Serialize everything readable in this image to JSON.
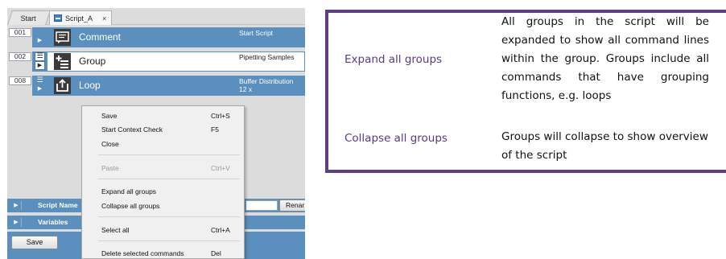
{
  "tabs": {
    "start_label": "Start",
    "script_label": "Script_A",
    "close_glyph": "×"
  },
  "commands": [
    {
      "number": "001",
      "label": "Comment",
      "detail": [
        "Start Script"
      ],
      "icon": "comment-icon"
    },
    {
      "number": "002",
      "label": "Group",
      "detail": [
        "Pipetting Samples"
      ],
      "icon": "group-icon"
    },
    {
      "number": "008",
      "label": "Loop",
      "detail": [
        "Buffer Distribution",
        "12 x"
      ],
      "icon": "loop-icon"
    }
  ],
  "context_menu": {
    "items": [
      {
        "label": "Save",
        "shortcut": "Ctrl+S",
        "enabled": true
      },
      {
        "label": "Start Context Check",
        "shortcut": "F5",
        "enabled": true
      },
      {
        "label": "Close",
        "shortcut": "",
        "enabled": true
      },
      {
        "label": "Paste",
        "shortcut": "Ctrl+V",
        "enabled": false
      },
      {
        "label": "Expand all groups",
        "shortcut": "",
        "enabled": true
      },
      {
        "label": "Collapse all groups",
        "shortcut": "",
        "enabled": true
      },
      {
        "label": "Select all",
        "shortcut": "Ctrl+A",
        "enabled": true
      },
      {
        "label": "Delete selected commands",
        "shortcut": "Del",
        "enabled": true
      }
    ]
  },
  "properties": {
    "script_name_label": "Script Name",
    "variables_label": "Variables",
    "rename_button": "Renar",
    "save_button": "Save"
  },
  "explanations": [
    {
      "option": "Expand all groups",
      "lines": [
        "All groups in the script will be",
        "expanded to show all command lines",
        "within the group. Groups include all",
        "commands that have grouping",
        "functions, e.g. loops"
      ]
    },
    {
      "option": "Collapse all groups",
      "lines": [
        "Groups will collapse to show overview",
        "of the script"
      ]
    }
  ],
  "colors": {
    "accent": "#5b8fbd",
    "table_border": "#5e3f86",
    "option_text": "#5a3a86"
  }
}
